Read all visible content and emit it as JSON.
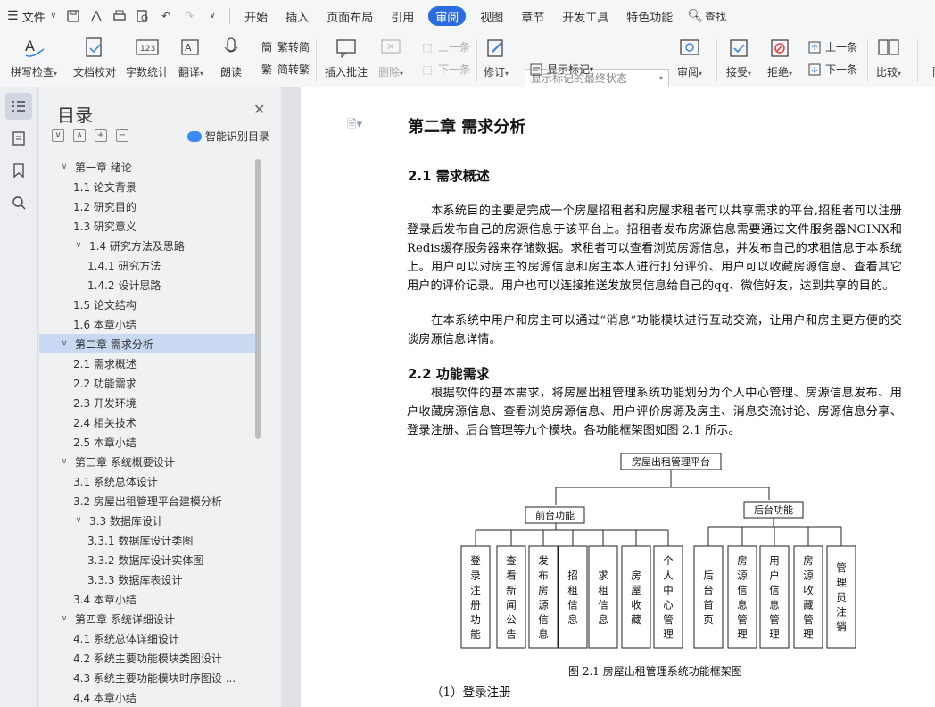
{
  "menubar": {
    "file_label": "文件",
    "tabs": [
      "开始",
      "插入",
      "页面布局",
      "引用",
      "审阅",
      "视图",
      "章节",
      "开发工具",
      "特色功能"
    ],
    "active_tab": "审阅",
    "search_label": "查找"
  },
  "toolbar": {
    "spell": "拼写检查",
    "doc_check": "文档校对",
    "word_count": "字数统计",
    "translate": "翻译",
    "read_aloud": "朗读",
    "trad_to_simp": "繁转简",
    "simp_to_trad": "简转繁",
    "insert_comment": "插入批注",
    "delete": "删除",
    "prev": "上一条",
    "next": "下一条",
    "revise": "修订",
    "display_state": "显示标记的最终状态",
    "show_marks": "显示标记",
    "review": "审阅",
    "accept": "接受",
    "reject": "拒绝",
    "prev2": "上一条",
    "next2": "下一条",
    "compare": "比较",
    "limit": "限"
  },
  "toc": {
    "title": "目录",
    "smart": "智能识别目录",
    "items": [
      {
        "level": 0,
        "label": "第一章  绪论",
        "expand": true
      },
      {
        "level": 1,
        "label": "1.1  论文背景"
      },
      {
        "level": 1,
        "label": "1.2  研究目的"
      },
      {
        "level": 1,
        "label": "1.3  研究意义"
      },
      {
        "level": 1,
        "label": "1.4  研究方法及思路",
        "expand": true
      },
      {
        "level": 2,
        "label": "1.4.1  研究方法"
      },
      {
        "level": 2,
        "label": "1.4.2  设计思路"
      },
      {
        "level": 1,
        "label": "1.5  论文结构"
      },
      {
        "level": 1,
        "label": "1.6  本章小结"
      },
      {
        "level": 0,
        "label": "第二章  需求分析",
        "expand": true,
        "selected": true
      },
      {
        "level": 1,
        "label": "2.1  需求概述"
      },
      {
        "level": 1,
        "label": "2.2  功能需求"
      },
      {
        "level": 1,
        "label": "2.3  开发环境"
      },
      {
        "level": 1,
        "label": "2.4  相关技术"
      },
      {
        "level": 1,
        "label": "2.5  本章小结"
      },
      {
        "level": 0,
        "label": "第三章  系统概要设计",
        "expand": true
      },
      {
        "level": 1,
        "label": "3.1  系统总体设计"
      },
      {
        "level": 1,
        "label": "3.2  房屋出租管理平台建模分析"
      },
      {
        "level": 1,
        "label": "3.3 数据库设计",
        "expand": true
      },
      {
        "level": 2,
        "label": "3.3.1  数据库设计类图"
      },
      {
        "level": 2,
        "label": "3.3.2  数据库设计实体图"
      },
      {
        "level": 2,
        "label": "3.3.3  数据库表设计"
      },
      {
        "level": 1,
        "label": "3.4  本章小结"
      },
      {
        "level": 0,
        "label": "第四章  系统详细设计",
        "expand": true
      },
      {
        "level": 1,
        "label": "4.1  系统总体详细设计"
      },
      {
        "level": 1,
        "label": "4.2  系统主要功能模块类图设计"
      },
      {
        "level": 1,
        "label": "4.3  系统主要功能模块时序图设 ..."
      },
      {
        "level": 1,
        "label": "4.4  本章小结"
      }
    ]
  },
  "doc": {
    "chapter_title": "第二章  需求分析",
    "s21_title": "2.1  需求概述",
    "s21_p1": "本系统目的主要是完成一个房屋招租者和房屋求租者可以共享需求的平台,招租者可以注册登录后发布自己的房源信息于该平台上。招租者发布房源信息需要通过文件服务器NGINX和Redis缓存服务器来存储数据。求租者可以查看浏览房源信息，并发布自己的求租信息于本系统上。用户可以对房主的房源信息和房主本人进行打分评价、用户可以收藏房源信息、查看其它用户的评价记录。用户也可以连接推送发放员信息给自己的qq、微信好友，达到共享的目的。",
    "s21_p2": "在本系统中用户和房主可以通过“消息”功能模块进行互动交流，让用户和房主更方便的交谈房源信息详情。",
    "s22_title": "2.2  功能需求",
    "s22_p1": "根据软件的基本需求，将房屋出租管理系统功能划分为个人中心管理、房源信息发布、用户收藏房源信息、查看浏览房源信息、用户评价房源及房主、消息交流讨论、房源信息分享、登录注册、后台管理等九个模块。各功能框架图如图 2.1 所示。",
    "diagram": {
      "root": "房屋出租管理平台",
      "front": "前台功能",
      "back": "后台功能",
      "front_items": [
        "登录注册功能",
        "查看新闻公告",
        "发布房源信息",
        "招租信息",
        "求租信息",
        "房屋收藏",
        "个人中心管理"
      ],
      "back_items": [
        "后台首页",
        "房源信息管理",
        "用户信息管理",
        "房源收藏管理",
        "管理员注销"
      ]
    },
    "caption": "图 2.1 房屋出租管理系统功能框架图",
    "sub_heading": "（1）登录注册"
  }
}
